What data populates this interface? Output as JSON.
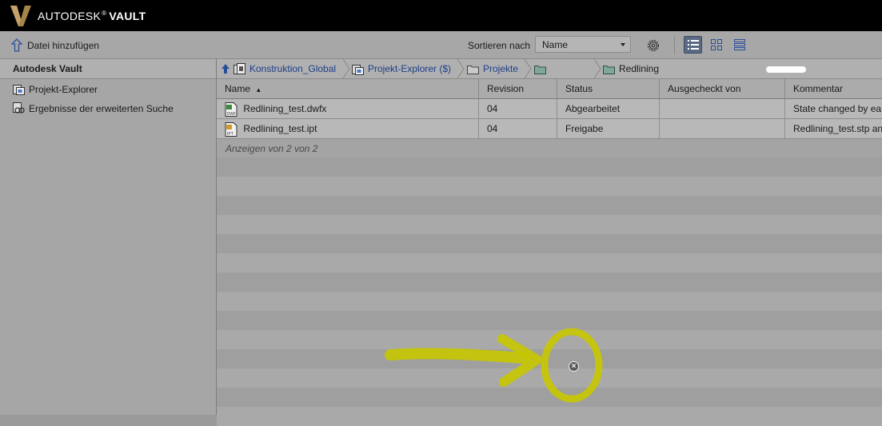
{
  "brand": {
    "name_primary": "AUTODESK",
    "reg": "®",
    "name_secondary": "VAULT"
  },
  "toolbar": {
    "add_file_label": "Datei hinzufügen",
    "sort_label": "Sortieren nach",
    "sort_value": "Name"
  },
  "sidebar": {
    "title": "Autodesk Vault",
    "items": [
      {
        "label": "Projekt-Explorer",
        "icon": "project-explorer-icon"
      },
      {
        "label": "Ergebnisse der erweiterten Suche",
        "icon": "advanced-search-icon"
      }
    ]
  },
  "breadcrumb": [
    {
      "label": "Konstruktion_Global"
    },
    {
      "label": "Projekt-Explorer ($)"
    },
    {
      "label": "Projekte"
    },
    {
      "label": ""
    },
    {
      "label": "Redlining"
    }
  ],
  "table": {
    "columns": [
      "Name",
      "Revision",
      "Status",
      "Ausgecheckt von",
      "Kommentar"
    ],
    "sort_indicator": "▲",
    "rows": [
      {
        "name": "Redlining_test.dwfx",
        "type": "DWF",
        "revision": "04",
        "status": "Abgearbeitet",
        "checked_out_by": "",
        "comment": "State changed by ea"
      },
      {
        "name": "Redlining_test.ipt",
        "type": "IPT",
        "revision": "04",
        "status": "Freigabe",
        "checked_out_by": "",
        "comment": "Redlining_test.stp an"
      }
    ],
    "footer": "Anzeigen von 2 von 2"
  },
  "colors": {
    "annotation": "#c6c600",
    "link": "#1d3f8a",
    "brand_gold": "#a6854a"
  }
}
